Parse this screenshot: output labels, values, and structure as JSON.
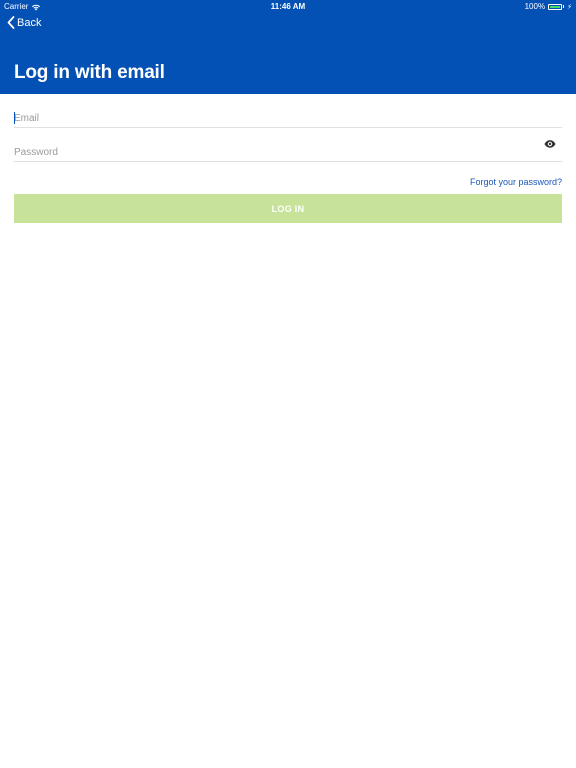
{
  "status_bar": {
    "carrier": "Carrier",
    "time": "11:46 AM",
    "battery": "100%",
    "battery_level": 1.0
  },
  "nav": {
    "back_label": "Back"
  },
  "header": {
    "title": "Log in with email",
    "background_color": "#0451b5"
  },
  "form": {
    "email_placeholder": "Email",
    "email_value": "",
    "password_placeholder": "Password",
    "password_value": "",
    "forgot_label": "Forgot your password?",
    "login_label": "LOG IN",
    "login_color": "#c7e39a"
  },
  "icons": {
    "back": "chevron-left-icon",
    "password_toggle": "eye-icon",
    "wifi": "wifi-icon",
    "battery": "battery-icon",
    "charging": "bolt-icon"
  }
}
